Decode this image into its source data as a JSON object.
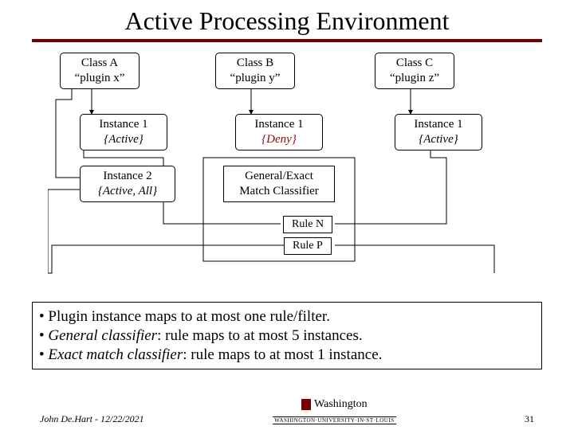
{
  "title": "Active Processing Environment",
  "classes": {
    "a": {
      "name": "Class A",
      "plugin": "“plugin x”"
    },
    "b": {
      "name": "Class B",
      "plugin": "“plugin y”"
    },
    "c": {
      "name": "Class C",
      "plugin": "“plugin z”"
    }
  },
  "instances": {
    "a1": {
      "label": "Instance 1",
      "state": "{Active}"
    },
    "a2": {
      "label": "Instance 2",
      "state": "{Active, All}"
    },
    "b1": {
      "label": "Instance 1",
      "state": "{Deny}"
    },
    "c1": {
      "label": "Instance 1",
      "state": "{Active}"
    }
  },
  "classifier": {
    "line1": "General/Exact",
    "line2": "Match Classifier"
  },
  "rules": {
    "n": "Rule N",
    "p": "Rule P"
  },
  "bullets": {
    "b1": "• Plugin instance maps to at most one rule/filter.",
    "b2_prefix": "• ",
    "b2_em": "General classifier",
    "b2_rest": ": rule maps to at most 5 instances.",
    "b3_prefix": "• ",
    "b3_em": "Exact match classifier",
    "b3_rest": ": rule maps to at most 1 instance."
  },
  "footer": {
    "author_date": "John De.Hart - 12/22/2021",
    "university": "Washington",
    "university_sub": "WASHINGTON·UNIVERSITY·IN·ST·LOUIS",
    "page": "31"
  }
}
